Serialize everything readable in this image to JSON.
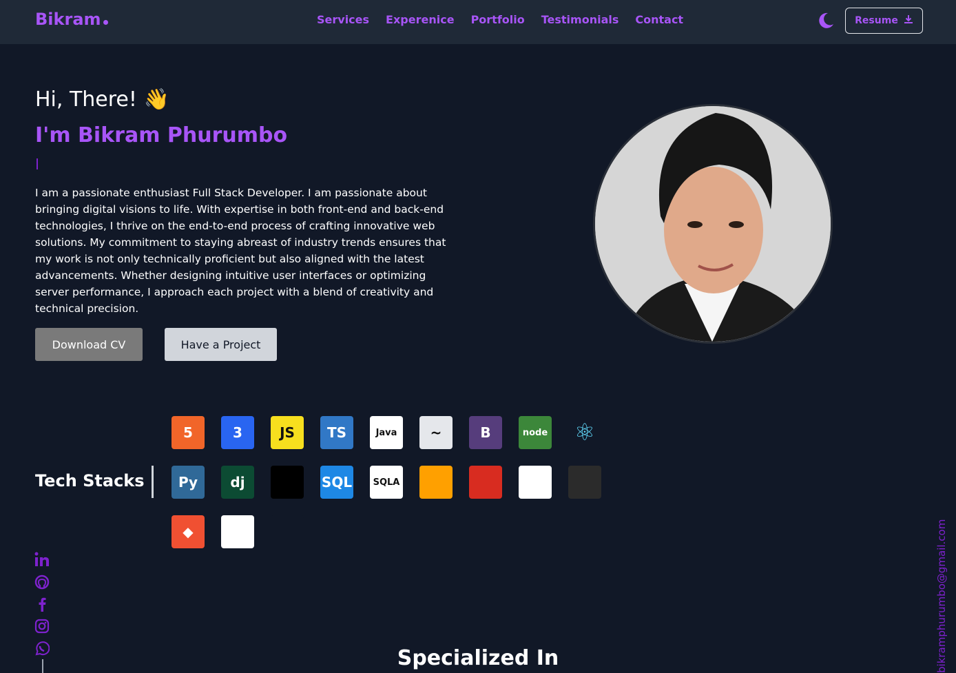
{
  "nav": {
    "logo": "Bikram",
    "links": [
      "Services",
      "Experenice",
      "Portfolio",
      "Testimonials",
      "Contact"
    ],
    "resume_label": "Resume"
  },
  "hero": {
    "greeting": "Hi, There!",
    "wave_emoji": "👋",
    "name": "I'm Bikram Phurumbo",
    "bio": "I am a passionate enthusiast Full Stack Developer. I am passionate about bringing digital visions to life. With expertise in both front-end and back-end technologies, I thrive on the end-to-end process of crafting innovative web solutions. My commitment to staying abreast of industry trends ensures that my work is not only technically proficient but also aligned with the latest advancements. Whether designing intuitive user interfaces or optimizing server performance, I approach each project with a blend of creativity and technical precision.",
    "download_cv": "Download CV",
    "have_project": "Have a Project"
  },
  "tech": {
    "title": "Tech Stacks",
    "row1": [
      {
        "icon": "html5-icon",
        "text": "5",
        "color": "#f16529"
      },
      {
        "icon": "css3-icon",
        "text": "3",
        "color": "#2965f1"
      },
      {
        "icon": "javascript-icon",
        "text": "JS",
        "color": "#f7df1e"
      },
      {
        "icon": "typescript-icon",
        "text": "TS",
        "color": "#3178c6"
      },
      {
        "icon": "java-icon",
        "text": "Java",
        "color": "#ffffff"
      },
      {
        "icon": "tailwind-icon",
        "text": "~",
        "color": "#e5e7eb"
      },
      {
        "icon": "bootstrap-icon",
        "text": "B",
        "color": "#563d7c"
      },
      {
        "icon": "nodejs-icon",
        "text": "node",
        "color": "#3c873a"
      },
      {
        "icon": "react-icon",
        "text": "⚛",
        "color": "#111827"
      }
    ],
    "row2": [
      {
        "icon": "python-icon",
        "text": "Py",
        "color": "#306998"
      },
      {
        "icon": "django-icon",
        "text": "dj",
        "color": "#0c4b33"
      },
      {
        "icon": "flask-icon",
        "text": "",
        "color": "#000000"
      },
      {
        "icon": "sql-icon",
        "text": "SQL",
        "color": "#1e88e5"
      },
      {
        "icon": "sqlalchemy-icon",
        "text": "SQLA",
        "color": "#ffffff"
      },
      {
        "icon": "firebase-icon",
        "text": "",
        "color": "#ffa000"
      },
      {
        "icon": "redis-icon",
        "text": "",
        "color": "#d82c20"
      },
      {
        "icon": "postgresql-icon",
        "text": "",
        "color": "#ffffff"
      },
      {
        "icon": "json-icon",
        "text": "",
        "color": "#2b2b2b"
      }
    ],
    "row3": [
      {
        "icon": "git-icon",
        "text": "◆",
        "color": "#f05032"
      },
      {
        "icon": "github-icon",
        "text": "",
        "color": "#ffffff"
      },
      {
        "icon": "vscode-icon",
        "text": "",
        "color": "#111827"
      }
    ]
  },
  "social": [
    "linkedin-icon",
    "github-icon",
    "facebook-icon",
    "instagram-icon",
    "whatsapp-icon"
  ],
  "email": "bikramphurumbo@gmail.com",
  "specialized_title": "Specialized In"
}
